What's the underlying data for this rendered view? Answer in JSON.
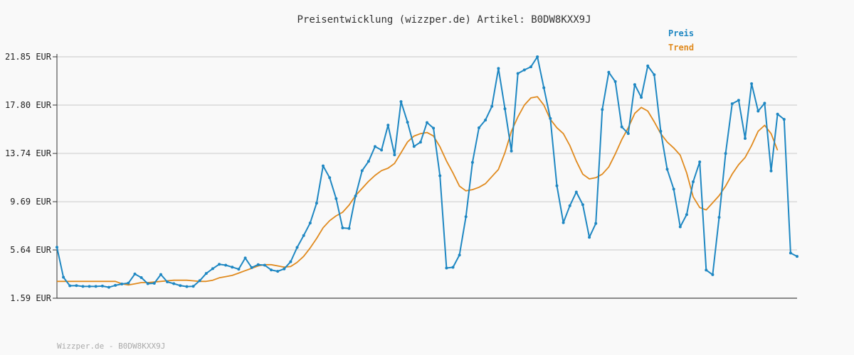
{
  "chart_data": {
    "type": "line",
    "title": "Preisentwicklung (wizzper.de) Artikel: B0DW8KXX9J",
    "footer": "Wizzper.de - B0DW8KXX9J",
    "y_ticks": [
      "21.85 EUR",
      "17.80 EUR",
      "13.74 EUR",
      "9.69 EUR",
      "5.64 EUR",
      "1.59 EUR"
    ],
    "y_tick_values": [
      21.85,
      17.8,
      13.74,
      9.69,
      5.64,
      1.59
    ],
    "ylim": [
      1.59,
      21.85
    ],
    "grid": true,
    "legend_position": "top-right",
    "series": [
      {
        "name": "Preis",
        "color": "#1e87c2",
        "markers": true,
        "values": [
          5.87,
          3.35,
          2.63,
          2.65,
          2.58,
          2.58,
          2.58,
          2.61,
          2.51,
          2.67,
          2.78,
          2.86,
          3.62,
          3.32,
          2.81,
          2.84,
          3.58,
          2.96,
          2.81,
          2.65,
          2.57,
          2.59,
          3.06,
          3.67,
          4.07,
          4.44,
          4.36,
          4.2,
          4.03,
          4.96,
          4.16,
          4.41,
          4.36,
          3.96,
          3.85,
          4.05,
          4.65,
          5.85,
          6.85,
          7.9,
          9.57,
          12.7,
          11.7,
          9.95,
          7.49,
          7.44,
          10.17,
          12.29,
          13.07,
          14.32,
          14.02,
          16.11,
          13.62,
          18.09,
          16.36,
          14.33,
          14.69,
          16.33,
          15.86,
          11.87,
          4.12,
          4.18,
          5.21,
          8.43,
          12.99,
          15.89,
          16.54,
          17.69,
          20.87,
          17.49,
          13.94,
          20.45,
          20.75,
          21.01,
          21.85,
          19.25,
          16.67,
          11.03,
          7.93,
          9.35,
          10.5,
          9.44,
          6.7,
          7.86,
          17.43,
          20.55,
          19.77,
          15.96,
          15.41,
          19.52,
          18.45,
          21.08,
          20.35,
          15.6,
          12.41,
          10.74,
          7.58,
          8.61,
          11.36,
          13.03,
          3.95,
          3.56,
          8.38,
          13.74,
          17.91,
          18.2,
          15.0,
          19.59,
          17.29,
          17.95,
          12.27,
          17.04,
          16.6,
          5.38,
          5.1
        ]
      },
      {
        "name": "Trend",
        "color": "#e08a1e",
        "markers": false,
        "values": [
          3.0,
          3.0,
          3.0,
          3.0,
          3.0,
          3.0,
          3.0,
          3.0,
          3.0,
          3.0,
          2.8,
          2.7,
          2.8,
          2.9,
          2.9,
          2.95,
          3.0,
          3.05,
          3.1,
          3.1,
          3.1,
          3.05,
          3.0,
          3.0,
          3.1,
          3.3,
          3.4,
          3.5,
          3.7,
          3.9,
          4.1,
          4.3,
          4.4,
          4.4,
          4.3,
          4.2,
          4.25,
          4.6,
          5.1,
          5.8,
          6.6,
          7.5,
          8.1,
          8.5,
          8.8,
          9.4,
          10.2,
          10.8,
          11.4,
          11.9,
          12.3,
          12.5,
          12.9,
          13.8,
          14.7,
          15.2,
          15.4,
          15.5,
          15.2,
          14.3,
          13.1,
          12.1,
          11.0,
          10.6,
          10.7,
          10.9,
          11.2,
          11.8,
          12.4,
          13.8,
          15.6,
          16.8,
          17.8,
          18.4,
          18.5,
          17.8,
          16.6,
          15.9,
          15.4,
          14.4,
          13.1,
          12.0,
          11.6,
          11.7,
          12.0,
          12.6,
          13.7,
          14.9,
          15.9,
          17.1,
          17.6,
          17.3,
          16.4,
          15.4,
          14.7,
          14.2,
          13.6,
          12.1,
          10.1,
          9.2,
          9.0,
          9.6,
          10.2,
          11.0,
          12.0,
          12.8,
          13.4,
          14.4,
          15.6,
          16.1,
          15.4,
          14.0
        ]
      }
    ]
  }
}
